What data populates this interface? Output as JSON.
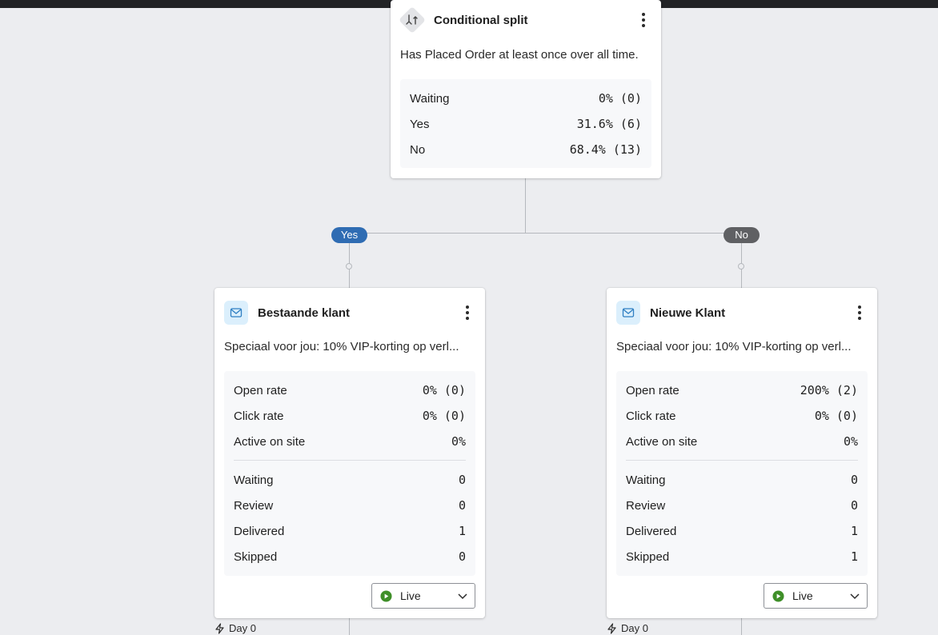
{
  "colors": {
    "canvas": "#ecedf0",
    "yes_pill": "#2f6cb3",
    "no_pill": "#5f6063",
    "live_green": "#3f8f29",
    "email_icon_bg": "#dbeffc"
  },
  "split": {
    "icon": "split-arrows-icon",
    "title": "Conditional split",
    "description": "Has Placed Order at least once over all time.",
    "stats": [
      {
        "label": "Waiting",
        "value": "0% (0)"
      },
      {
        "label": "Yes",
        "value": "31.6% (6)"
      },
      {
        "label": "No",
        "value": "68.4% (13)"
      }
    ]
  },
  "branches": {
    "yes_label": "Yes",
    "no_label": "No"
  },
  "emails": [
    {
      "icon": "envelope-icon",
      "title": "Bestaande klant",
      "subject": "Speciaal voor jou: 10% VIP-korting op verl...",
      "rates": [
        {
          "label": "Open rate",
          "value": "0% (0)"
        },
        {
          "label": "Click rate",
          "value": "0% (0)"
        },
        {
          "label": "Active on site",
          "value": "0%"
        }
      ],
      "counts": [
        {
          "label": "Waiting",
          "value": "0"
        },
        {
          "label": "Review",
          "value": "0"
        },
        {
          "label": "Delivered",
          "value": "1"
        },
        {
          "label": "Skipped",
          "value": "0"
        }
      ],
      "status": "Live",
      "delay": "Day 0"
    },
    {
      "icon": "envelope-icon",
      "title": "Nieuwe Klant",
      "subject": "Speciaal voor jou: 10% VIP-korting op verl...",
      "rates": [
        {
          "label": "Open rate",
          "value": "200% (2)"
        },
        {
          "label": "Click rate",
          "value": "0% (0)"
        },
        {
          "label": "Active on site",
          "value": "0%"
        }
      ],
      "counts": [
        {
          "label": "Waiting",
          "value": "0"
        },
        {
          "label": "Review",
          "value": "0"
        },
        {
          "label": "Delivered",
          "value": "1"
        },
        {
          "label": "Skipped",
          "value": "1"
        }
      ],
      "status": "Live",
      "delay": "Day 0"
    }
  ]
}
